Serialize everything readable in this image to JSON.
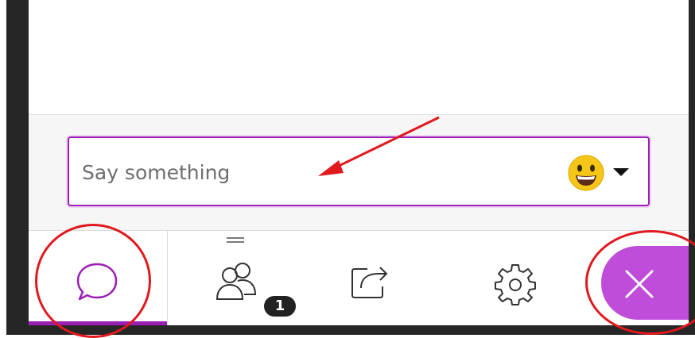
{
  "chat": {
    "input_placeholder": "Say something",
    "emoji_button": "emoji-picker"
  },
  "toolbar": {
    "tabs": [
      {
        "name": "chat",
        "icon": "chat-bubble-icon",
        "active": true
      },
      {
        "name": "attendees",
        "icon": "people-icon",
        "badge": "1"
      },
      {
        "name": "share-content",
        "icon": "share-icon"
      },
      {
        "name": "settings",
        "icon": "gear-icon"
      }
    ],
    "close_icon": "close-icon"
  },
  "colors": {
    "accent": "#9b1fb3",
    "close_button": "#c04dd9",
    "annotation": "#e0191e"
  }
}
